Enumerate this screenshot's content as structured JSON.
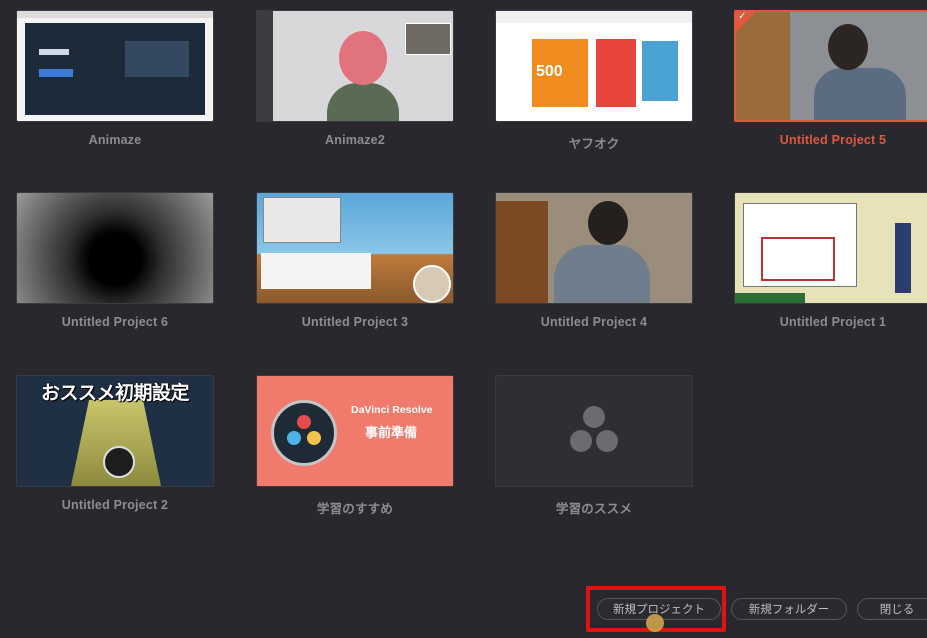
{
  "projects": [
    {
      "name": "Animaze"
    },
    {
      "name": "Animaze2"
    },
    {
      "name": "ヤフオク",
      "banner_text": "500"
    },
    {
      "name": "Untitled Project 5",
      "selected": true
    },
    {
      "name": "Untitled Project 6"
    },
    {
      "name": "Untitled Project 3"
    },
    {
      "name": "Untitled Project 4"
    },
    {
      "name": "Untitled Project 1"
    },
    {
      "name": "Untitled Project 2",
      "thumb_title": "おススメ初期設定"
    },
    {
      "name": "学習のすすめ",
      "thumb_title": "DaVinci Resolve",
      "thumb_subtitle": "事前準備"
    },
    {
      "name": "学習のススメ"
    }
  ],
  "footer": {
    "new_project_label": "新規プロジェクト",
    "new_folder_label": "新規フォルダー",
    "close_label": "閉じる"
  },
  "colors": {
    "selected_accent": "#e2583e",
    "highlight_box": "#e01212"
  }
}
